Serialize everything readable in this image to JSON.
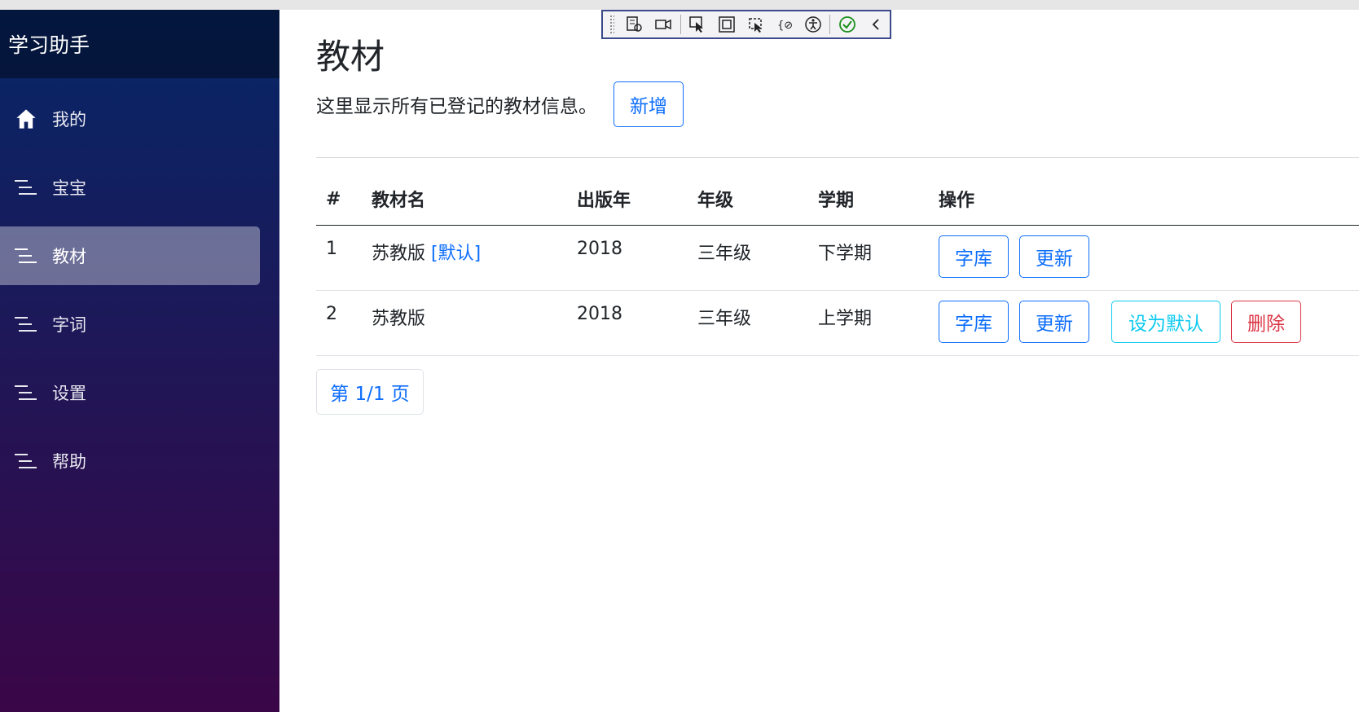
{
  "app": {
    "brand": "学习助手"
  },
  "sidebar": {
    "items": [
      {
        "label": "我的",
        "icon": "home-icon",
        "active": false
      },
      {
        "label": "宝宝",
        "icon": "list-icon",
        "active": false
      },
      {
        "label": "教材",
        "icon": "list-icon",
        "active": true
      },
      {
        "label": "字词",
        "icon": "list-icon",
        "active": false
      },
      {
        "label": "设置",
        "icon": "list-icon",
        "active": false
      },
      {
        "label": "帮助",
        "icon": "list-icon",
        "active": false
      }
    ]
  },
  "page": {
    "title": "教材",
    "subtitle": "这里显示所有已登记的教材信息。",
    "add_label": "新增"
  },
  "table": {
    "headers": [
      "#",
      "教材名",
      "出版年",
      "年级",
      "学期",
      "操作"
    ],
    "rows": [
      {
        "num": "1",
        "name": "苏教版",
        "default_tag": "[默认]",
        "year": "2018",
        "grade": "三年级",
        "term": "下学期",
        "actions": {
          "library": "字库",
          "update": "更新"
        }
      },
      {
        "num": "2",
        "name": "苏教版",
        "default_tag": "",
        "year": "2018",
        "grade": "三年级",
        "term": "上学期",
        "actions": {
          "library": "字库",
          "update": "更新",
          "set_default": "设为默认",
          "delete": "删除"
        }
      }
    ]
  },
  "pager": {
    "label": "第 1/1 页"
  },
  "colors": {
    "primary": "#0d6efd",
    "info": "#0dcaf0",
    "danger": "#dc3545",
    "sidebar_top": "#052767",
    "sidebar_bottom": "#3a0647"
  }
}
